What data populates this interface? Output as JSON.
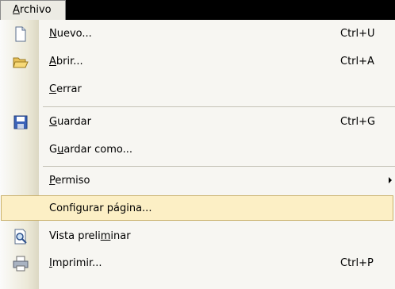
{
  "menu": {
    "title_pre": "",
    "title_mnemonic": "A",
    "title_post": "rchivo"
  },
  "items": [
    {
      "pre": "",
      "mn": "N",
      "post": "uevo...",
      "shortcut": "Ctrl+U",
      "icon": "new-document-icon"
    },
    {
      "pre": "",
      "mn": "A",
      "post": "brir...",
      "shortcut": "Ctrl+A",
      "icon": "open-folder-icon"
    },
    {
      "pre": "",
      "mn": "C",
      "post": "errar",
      "shortcut": "",
      "icon": ""
    },
    {
      "pre": "",
      "mn": "G",
      "post": "uardar",
      "shortcut": "Ctrl+G",
      "icon": "save-disk-icon"
    },
    {
      "pre": "G",
      "mn": "u",
      "post": "ardar como...",
      "shortcut": "",
      "icon": ""
    },
    {
      "pre": "",
      "mn": "P",
      "post": "ermiso",
      "shortcut": "",
      "icon": "",
      "submenu": true
    },
    {
      "pre": "Confi",
      "mn": "g",
      "post": "urar página...",
      "shortcut": "",
      "icon": "",
      "highlighted": true
    },
    {
      "pre": "Vista preli",
      "mn": "m",
      "post": "inar",
      "shortcut": "",
      "icon": "print-preview-icon"
    },
    {
      "pre": "",
      "mn": "I",
      "post": "mprimir...",
      "shortcut": "Ctrl+P",
      "icon": "printer-icon"
    }
  ],
  "colors": {
    "highlight_fill": "#fcefc5",
    "highlight_border": "#c9b06b",
    "menu_background": "#f7f6f2",
    "menubar": "#000000"
  }
}
